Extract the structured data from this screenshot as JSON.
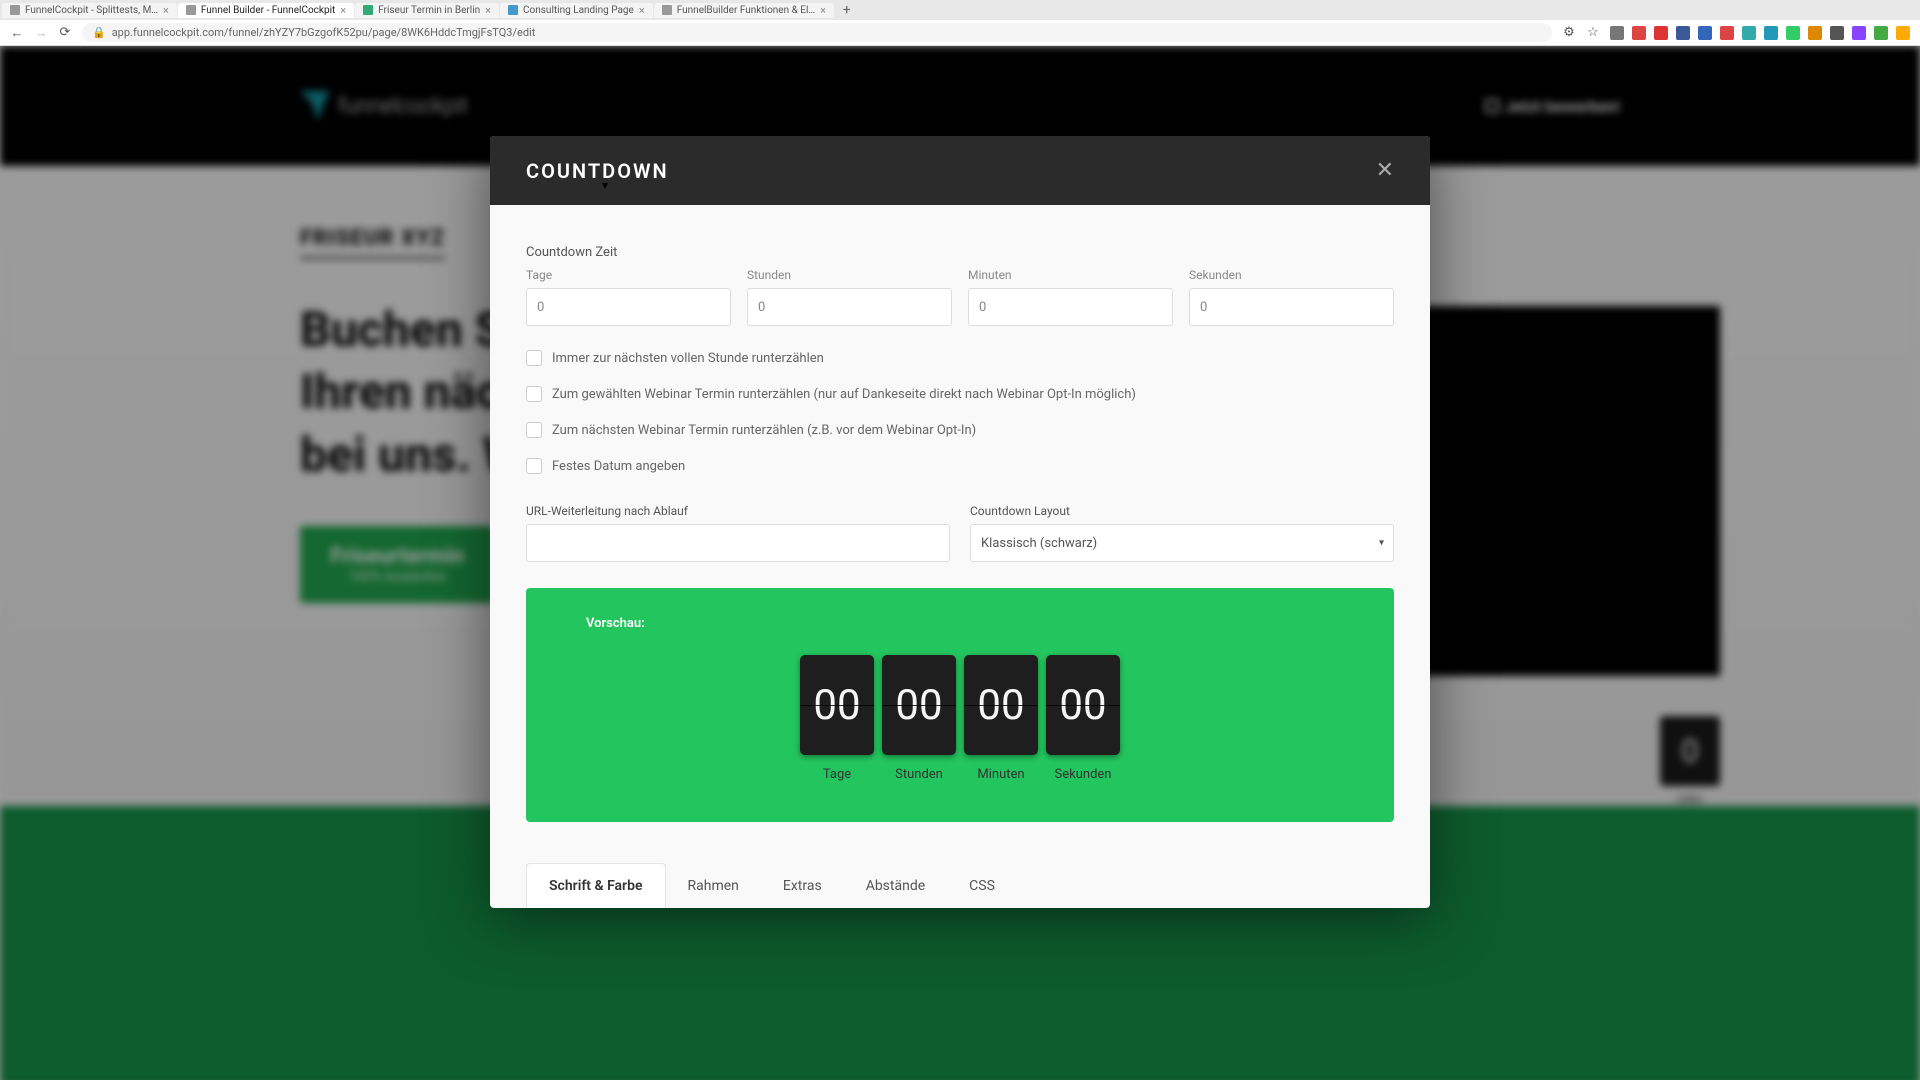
{
  "browser": {
    "tabs": [
      {
        "title": "FunnelCockpit - Splittests, M…",
        "active": false
      },
      {
        "title": "Funnel Builder - FunnelCockpit",
        "active": true
      },
      {
        "title": "Friseur Termin in Berlin",
        "active": false
      },
      {
        "title": "Consulting Landing Page",
        "active": false
      },
      {
        "title": "FunnelBuilder Funktionen & El…",
        "active": false
      }
    ],
    "url": "app.funnelcockpit.com/funnel/zhYZY7bGzgofK52pu/page/8WK6HddcTmgjFsTQ3/edit"
  },
  "topnav": {
    "logo_text": "funnelcockpit",
    "apply": "Jetzt bewerben!"
  },
  "hero": {
    "brand": "FRISEUR XYZ",
    "headline_l1": "Buchen Si",
    "headline_l2": "Ihren näch",
    "headline_l3": "bei uns. W",
    "cta_main": "Friseurtermin",
    "cta_sub": "100% kostenlos"
  },
  "bg_countdown": {
    "val": "0",
    "label": "nden"
  },
  "modal": {
    "title": "COUNTDOWN",
    "section": "Countdown Zeit",
    "time": {
      "days": {
        "label": "Tage",
        "value": "0"
      },
      "hours": {
        "label": "Stunden",
        "value": "0"
      },
      "minutes": {
        "label": "Minuten",
        "value": "0"
      },
      "seconds": {
        "label": "Sekunden",
        "value": "0"
      }
    },
    "checks": {
      "c1": "Immer zur nächsten vollen Stunde runterzählen",
      "c2": "Zum gewählten Webinar Termin runterzählen (nur auf Dankeseite direkt nach Webinar Opt-In möglich)",
      "c3": "Zum nächsten Webinar Termin runterzählen (z.B. vor dem Webinar Opt-In)",
      "c4": "Festes Datum angeben"
    },
    "url_redirect": {
      "label": "URL-Weiterleitung nach Ablauf",
      "value": ""
    },
    "layout": {
      "label": "Countdown Layout",
      "value": "Klassisch (schwarz)"
    },
    "preview": {
      "label": "Vorschau:",
      "items": [
        {
          "val": "00",
          "lbl": "Tage"
        },
        {
          "val": "00",
          "lbl": "Stunden"
        },
        {
          "val": "00",
          "lbl": "Minuten"
        },
        {
          "val": "00",
          "lbl": "Sekunden"
        }
      ]
    },
    "tabs": [
      "Schrift & Farbe",
      "Rahmen",
      "Extras",
      "Abstände",
      "CSS"
    ],
    "active_tab": 0
  },
  "ext_colors": [
    "#777",
    "#d44",
    "#d33",
    "#3b5998",
    "#36b",
    "#d44",
    "#3aa",
    "#29b",
    "#3c6",
    "#d80",
    "#555",
    "#84f",
    "#4a4",
    "#fa0"
  ]
}
